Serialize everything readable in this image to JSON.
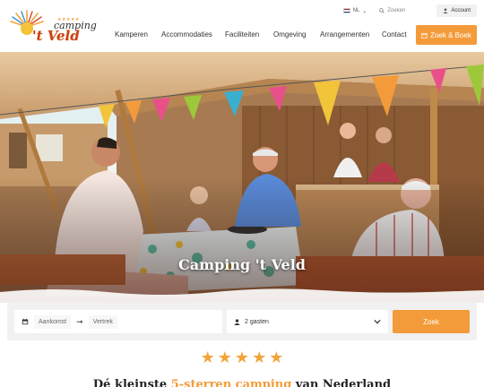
{
  "brand": {
    "stars": "★★★★★",
    "word1": "camping",
    "word2": "'t Veld"
  },
  "topbar": {
    "language": "NL",
    "search_placeholder": "Zoeken",
    "account_label": "Account"
  },
  "nav": {
    "items": [
      {
        "label": "Kamperen"
      },
      {
        "label": "Accommodaties"
      },
      {
        "label": "Faciliteiten"
      },
      {
        "label": "Omgeving"
      },
      {
        "label": "Arrangementen"
      },
      {
        "label": "Contact"
      }
    ],
    "cta_label": "Zoek & Boek"
  },
  "hero": {
    "title": "Camping 't Veld"
  },
  "booking": {
    "arrival_placeholder": "Aankomst",
    "departure_placeholder": "Vertrek",
    "guests_value": "2 gasten",
    "search_label": "Zoek"
  },
  "rating": {
    "stars": 5
  },
  "tagline": {
    "prefix": "Dé kleinste ",
    "accent": "5-sterren camping",
    "suffix": " van Nederland"
  },
  "colors": {
    "accent": "#f39b3a",
    "brand_red": "#c94020",
    "star": "#f2a33a"
  }
}
